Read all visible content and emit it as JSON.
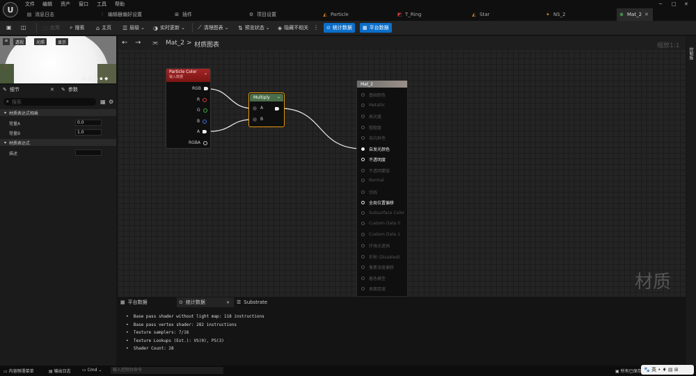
{
  "app": {
    "logo": "U"
  },
  "menu": [
    "文件",
    "编辑",
    "资产",
    "窗口",
    "工具",
    "帮助"
  ],
  "window_controls": [
    "─",
    "□",
    "✕"
  ],
  "tabs": [
    {
      "label": "消息日志",
      "icon": "log-icon"
    },
    {
      "label": "编辑器偏好设置",
      "icon": "sliders-icon"
    },
    {
      "label": "插件",
      "icon": "plugin-icon"
    },
    {
      "label": "项目设置",
      "icon": "gear-icon"
    },
    {
      "label": "Particle",
      "icon": "material-icon"
    },
    {
      "label": "T_Ring",
      "icon": "texture-icon"
    },
    {
      "label": "Star",
      "icon": "material-icon"
    },
    {
      "label": "NS_2",
      "icon": "niagara-icon"
    },
    {
      "label": "Mat_2",
      "icon": "material-green-icon"
    }
  ],
  "toolbar": {
    "apply": "应用",
    "search": "搜索",
    "home": "主页",
    "hierarchy": "层级",
    "live_update": "实时更新",
    "clean_graph": "清理图表",
    "preview_state": "预览状态",
    "hide_unrelated": "隐藏不相关",
    "stats": "统计数据",
    "platform_stats": "平台数据"
  },
  "viewport": {
    "buttons": [
      "透视",
      "光照",
      "显示"
    ]
  },
  "details": {
    "tabs": [
      "细节",
      "参数"
    ],
    "search_placeholder": "搜索",
    "section1": "材质表达式相乘",
    "const_a_label": "常量A",
    "const_a_value": "0.0",
    "const_b_label": "常量B",
    "const_b_value": "1.0",
    "section2": "材质表达式",
    "desc_label": "描述"
  },
  "graph": {
    "breadcrumb_asset": "Mat_2",
    "breadcrumb_sep": ">",
    "breadcrumb_page": "材质图表",
    "zoom": "缩放1:1",
    "watermark": "材质"
  },
  "particle_node": {
    "title": "Particle Color",
    "subtitle": "输入数据",
    "pins": [
      "RGB",
      "R",
      "G",
      "B",
      "A",
      "RGBA"
    ],
    "pin_colors": [
      "#eeeeee",
      "#e03a3a",
      "#3ab53a",
      "#4a6ee0",
      "#eeeeee",
      "#eeeeee"
    ]
  },
  "multiply_node": {
    "title": "Multiply",
    "pin_a": "A",
    "pin_b": "B"
  },
  "mat_node": {
    "title": "Mat_2",
    "inputs": [
      {
        "label": "基础颜色",
        "on": false
      },
      {
        "label": "Metallic",
        "on": false
      },
      {
        "label": "高光度",
        "on": false
      },
      {
        "label": "粗糙度",
        "on": false
      },
      {
        "label": "各向异性",
        "on": false
      },
      {
        "label": "自发光颜色",
        "on": true,
        "filled": true
      },
      {
        "label": "不透明度",
        "on": true
      },
      {
        "label": "不透明蒙版",
        "on": false
      },
      {
        "label": "Normal",
        "on": false
      },
      {
        "label": "切线",
        "on": false
      },
      {
        "label": "全局位置偏移",
        "on": true
      },
      {
        "label": "Subsurface Color",
        "on": false
      },
      {
        "label": "Custom Data 0",
        "on": false
      },
      {
        "label": "Custom Data 1",
        "on": false
      },
      {
        "label": "环境光遮挡",
        "on": false
      },
      {
        "label": "折射 (Disabled)",
        "on": false
      },
      {
        "label": "像素深度偏移",
        "on": false
      },
      {
        "label": "着色模型",
        "on": false
      },
      {
        "label": "表面厚度",
        "on": false
      }
    ]
  },
  "bottom_panel": {
    "tabs": [
      "平台数据",
      "统计数据",
      "Substrate"
    ],
    "stats": [
      "Base pass shader without light map: 118 instructions",
      "Base pass vertex shader: 282 instructions",
      "Texture samplers: 7/16",
      "Texture Lookups (Est.): VS(0), PS(3)",
      "Shader Count: 28"
    ]
  },
  "right_sidebar": {
    "label": "控制板"
  },
  "statusbar": {
    "content_drawer": "内容侧滑菜单",
    "output_log": "输出日志",
    "cmd": "Cmd",
    "console_placeholder": "输入控制台命令",
    "saved": "所有已保存",
    "ime": "英"
  },
  "colors": {
    "accent_blue": "#0b6ec9",
    "particle_header": "#8e1c1c",
    "multiply_header": "#3d5a3d",
    "multiply_border": "#e89a10"
  }
}
